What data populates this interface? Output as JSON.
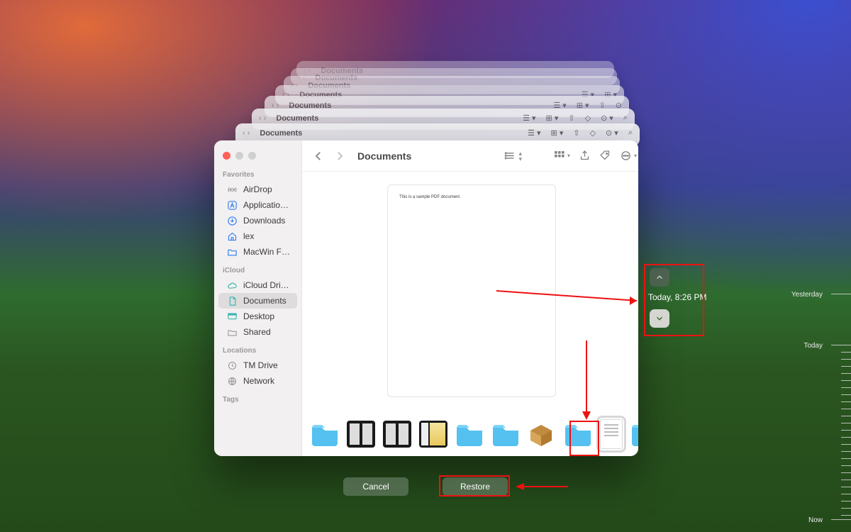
{
  "window": {
    "title": "Documents",
    "breadcrumb_title": "Documents"
  },
  "sidebar": {
    "sections": [
      {
        "label": "Favorites",
        "items": [
          {
            "icon": "airdrop",
            "label": "AirDrop",
            "color": "#9a9a9c"
          },
          {
            "icon": "app",
            "label": "Applicatio…",
            "color": "#2f7cf6"
          },
          {
            "icon": "download",
            "label": "Downloads",
            "color": "#2f7cf6"
          },
          {
            "icon": "home",
            "label": "lex",
            "color": "#2f7cf6"
          },
          {
            "icon": "folder",
            "label": "MacWin F…",
            "color": "#2f7cf6"
          }
        ]
      },
      {
        "label": "iCloud",
        "items": [
          {
            "icon": "cloud",
            "label": "iCloud Dri…",
            "color": "#36b3b3"
          },
          {
            "icon": "doc",
            "label": "Documents",
            "color": "#36b3b3",
            "selected": true
          },
          {
            "icon": "desktop",
            "label": "Desktop",
            "color": "#36b3b3"
          },
          {
            "icon": "shared",
            "label": "Shared",
            "color": "#9a9a9c"
          }
        ]
      },
      {
        "label": "Locations",
        "items": [
          {
            "icon": "clock",
            "label": "TM Drive",
            "color": "#9a9a9c"
          },
          {
            "icon": "globe",
            "label": "Network",
            "color": "#9a9a9c"
          }
        ]
      },
      {
        "label": "Tags",
        "items": []
      }
    ]
  },
  "preview": {
    "text": "This is a sample PDF document."
  },
  "buttons": {
    "cancel": "Cancel",
    "restore": "Restore"
  },
  "nav_time": "Today, 8:26 PM",
  "timeline": {
    "labels": [
      "Yesterday",
      "Today",
      "Now"
    ]
  }
}
